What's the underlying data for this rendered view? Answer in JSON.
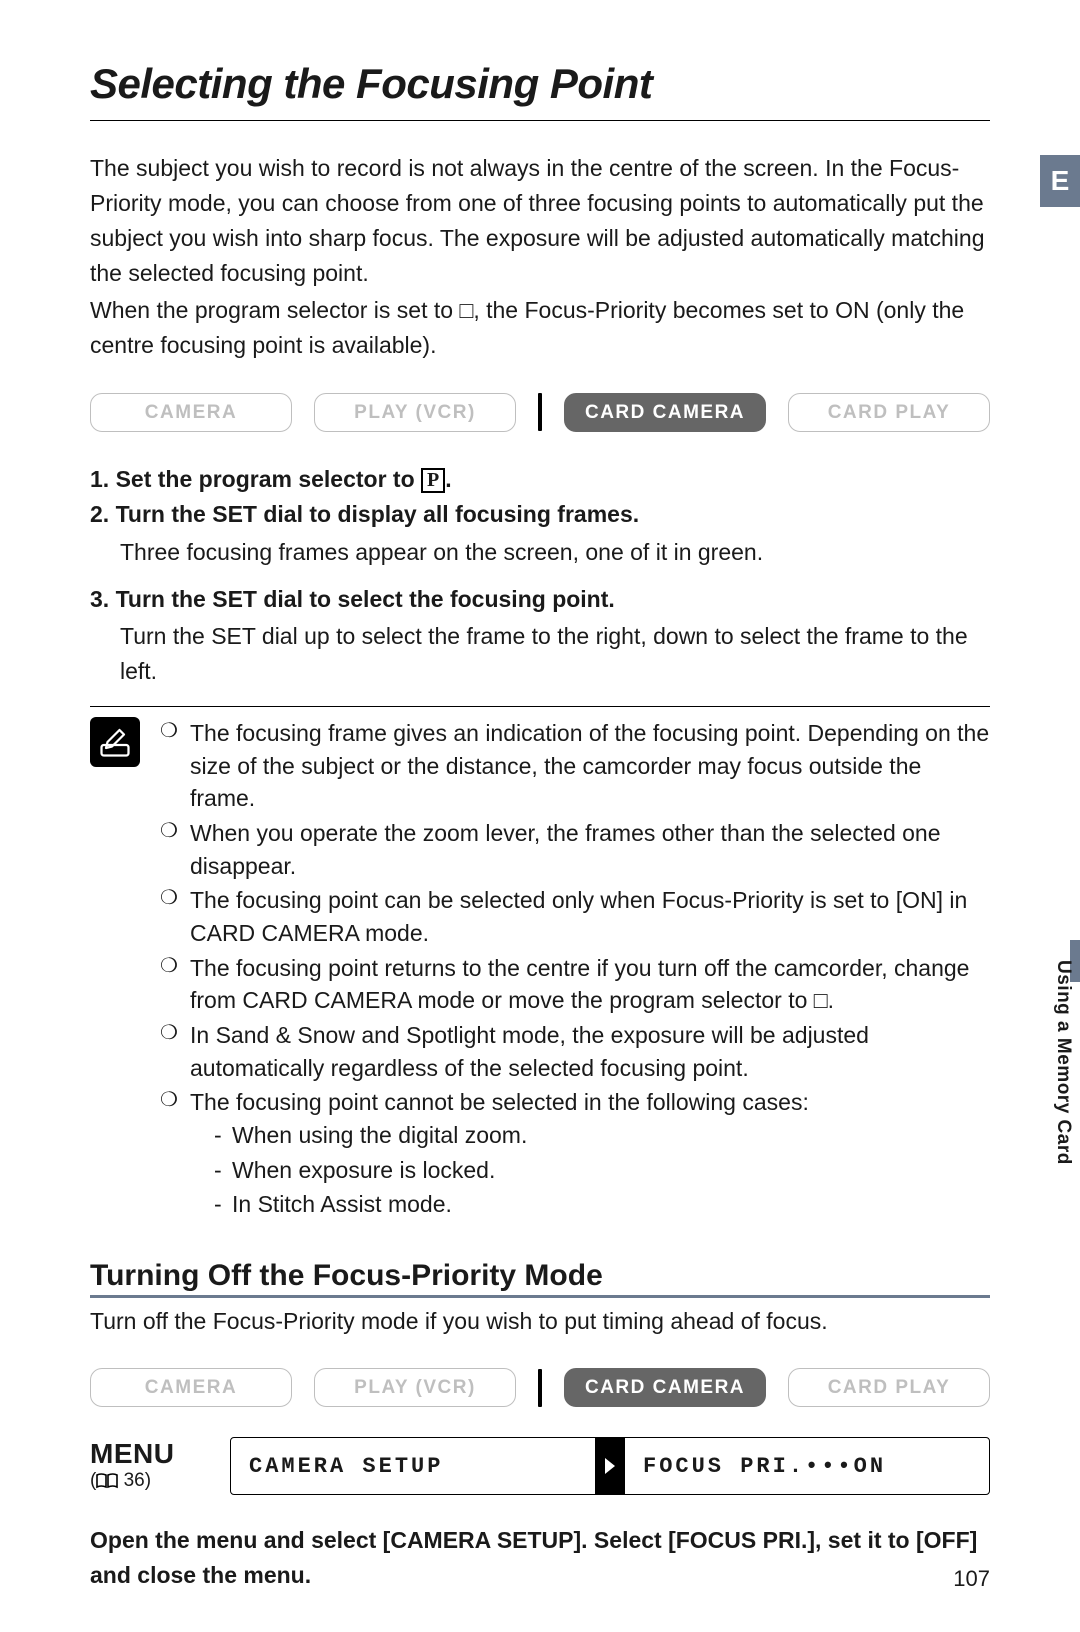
{
  "lang_tab": "E",
  "side_label": "Using a Memory Card",
  "title": "Selecting the Focusing Point",
  "intro": [
    "The subject you wish to record is not always in the centre of the screen. In the Focus-Priority mode, you can choose from one of three focusing points to automatically put the subject you wish into sharp focus. The exposure will be adjusted automatically matching the selected focusing point.",
    "When the program selector is set to □, the Focus-Priority becomes set to ON (only the centre focusing point is available)."
  ],
  "modes": {
    "camera": "CAMERA",
    "play_vcr": "PLAY (VCR)",
    "card_camera": "CARD CAMERA",
    "card_play": "CARD PLAY"
  },
  "steps": [
    {
      "head_pre": "1. Set the program selector to ",
      "head_post": "."
    },
    {
      "head": "2. Turn the SET dial to display all focusing frames.",
      "body": "Three focusing frames appear on the screen, one of it in green."
    },
    {
      "head": "3. Turn the SET dial to select the focusing point.",
      "body": "Turn the SET dial up to select the frame to the right, down to select the frame to the left."
    }
  ],
  "notes": [
    "The focusing frame gives an indication of the focusing point. Depending on the size of the subject or the distance, the camcorder may focus outside the frame.",
    "When you operate the zoom lever, the frames other than the selected one disappear.",
    "The focusing point can be selected only when Focus-Priority is set to [ON] in CARD CAMERA mode.",
    "The focusing point returns to the centre if you turn off the camcorder, change from CARD CAMERA mode or move the program selector to □.",
    "In Sand & Snow and Spotlight mode, the exposure will be adjusted automatically regardless of the selected focusing point.",
    "The focusing point cannot be selected in the following cases:"
  ],
  "note_sublist": [
    "When using the digital zoom.",
    "When exposure is locked.",
    "In Stitch Assist mode."
  ],
  "h2": "Turning Off the Focus-Priority Mode",
  "sub_intro": "Turn off the Focus-Priority mode if you wish to put timing ahead of focus.",
  "menu": {
    "label": "MENU",
    "ref_page": "36",
    "left": "CAMERA SETUP",
    "right": "FOCUS PRI.•••ON"
  },
  "final": "Open the menu and select [CAMERA SETUP]. Select [FOCUS PRI.], set it to [OFF] and close the menu.",
  "page_number": "107"
}
